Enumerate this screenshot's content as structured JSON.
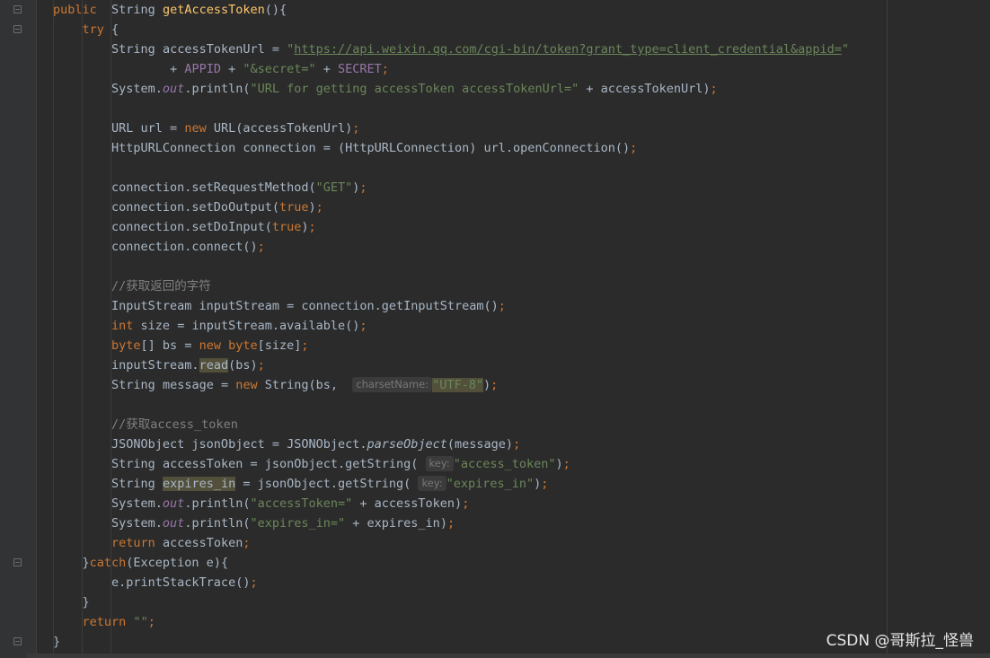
{
  "code": {
    "kw_public": "public",
    "kw_try": "try",
    "kw_new": "new",
    "kw_int": "int",
    "kw_byte": "byte",
    "kw_return": "return",
    "kw_catch": "catch",
    "type_string": "String",
    "method_name": "getAccessToken",
    "var_access_token_url": "accessTokenUrl",
    "url_literal": "https://api.weixin.qq.com/cgi-bin/token?grant_type=client_credential&appid=",
    "const_appid": "APPID",
    "str_secret": "\"&secret=\"",
    "const_secret": "SECRET",
    "field_out": "out",
    "str_url_msg": "\"URL for getting accessToken accessTokenUrl=\"",
    "str_get": "\"GET\"",
    "kw_true": "true",
    "comment_return_chars": "//获取返回的字符",
    "method_read": "read",
    "hint_charset": "charsetName:",
    "str_utf8": "\"UTF-8\"",
    "comment_access_token": "//获取access_token",
    "method_parse": "parseObject",
    "hint_key": "key:",
    "str_access_token_key": "\"access_token\"",
    "var_expires_in": "expires_in",
    "str_expires_key": "\"expires_in\"",
    "str_access_msg": "\"accessToken=\"",
    "str_expires_msg": "\"expires_in=\"",
    "str_empty": "\"\""
  },
  "watermark": "CSDN @哥斯拉_怪兽",
  "colors": {
    "background": "#2b2b2b",
    "keyword": "#cc7832",
    "string": "#6a8759",
    "method": "#ffc66d",
    "constant": "#9876aa",
    "comment": "#808080",
    "default_text": "#a9b7c6"
  }
}
